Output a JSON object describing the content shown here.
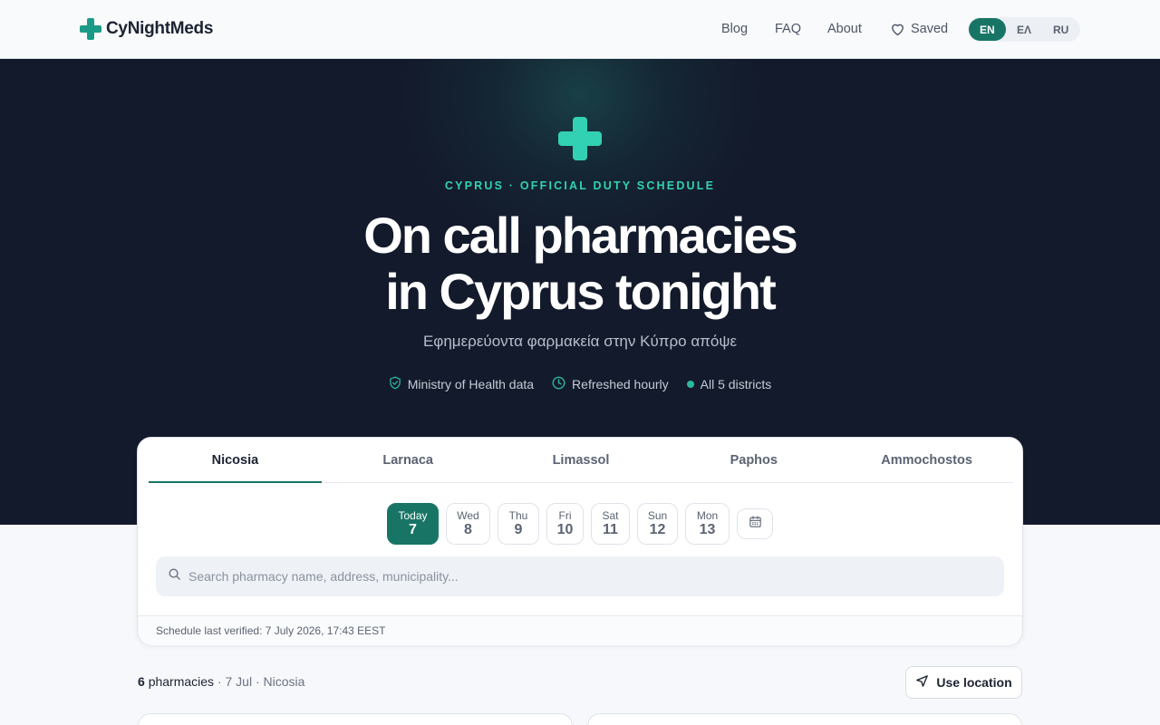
{
  "header": {
    "logo_text": "CyNightMeds",
    "nav": {
      "blog": "Blog",
      "faq": "FAQ",
      "about": "About",
      "saved": "Saved"
    },
    "languages": [
      {
        "label": "EN",
        "active": true
      },
      {
        "label": "ΕΛ",
        "active": false
      },
      {
        "label": "RU",
        "active": false
      }
    ]
  },
  "hero": {
    "eyebrow": "CYPRUS · OFFICIAL DUTY SCHEDULE",
    "title_line1": "On call pharmacies",
    "title_line2": "in Cyprus tonight",
    "subtitle": "Εφημερεύοντα φαρμακεία στην Κύπρο απόψε",
    "badges": {
      "source": "Ministry of Health data",
      "refresh": "Refreshed hourly",
      "districts": "All 5 districts"
    }
  },
  "search_card": {
    "tabs": [
      "Nicosia",
      "Larnaca",
      "Limassol",
      "Paphos",
      "Ammochostos"
    ],
    "active_tab": "Nicosia",
    "dates": [
      {
        "day": "Today",
        "date": "7",
        "active": true
      },
      {
        "day": "Wed",
        "date": "8",
        "active": false
      },
      {
        "day": "Thu",
        "date": "9",
        "active": false
      },
      {
        "day": "Fri",
        "date": "10",
        "active": false
      },
      {
        "day": "Sat",
        "date": "11",
        "active": false
      },
      {
        "day": "Sun",
        "date": "12",
        "active": false
      },
      {
        "day": "Mon",
        "date": "13",
        "active": false
      }
    ],
    "search_placeholder": "Search pharmacy name, address, municipality...",
    "search_value": "",
    "footer": "Schedule last verified: 7 July 2026, 17:43 EEST"
  },
  "results": {
    "count": "6",
    "count_label": "pharmacies",
    "meta": " · 7 Jul · Nicosia",
    "use_location": "Use location"
  },
  "colors": {
    "brand": "#187566",
    "accent": "#33d1b3",
    "hero_bg": "#131a2b"
  }
}
